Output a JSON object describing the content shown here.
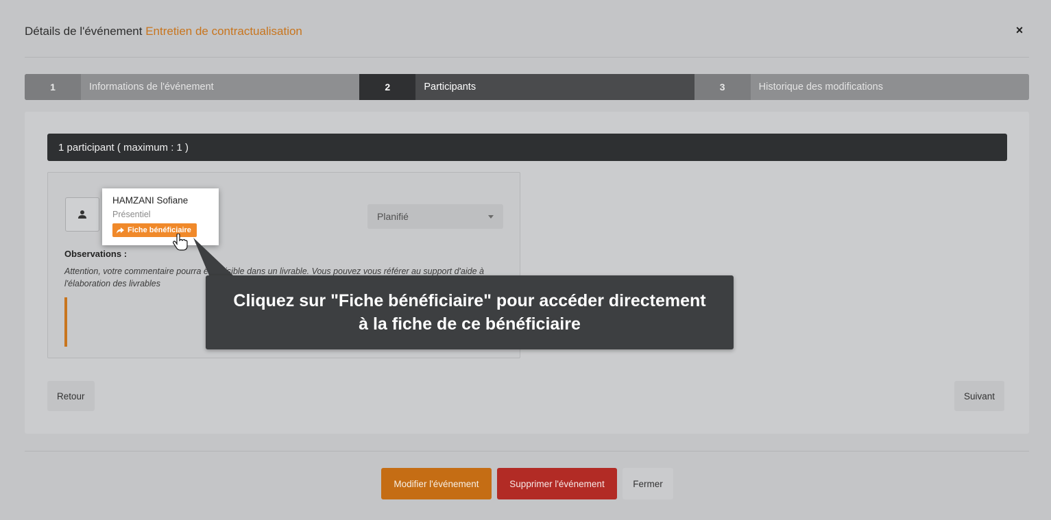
{
  "modal": {
    "title_prefix": "Détails de l'événement",
    "title_event": "Entretien de contractualisation",
    "close_symbol": "×"
  },
  "steps": [
    {
      "num": "1",
      "label": "Informations de l'événement",
      "active": false
    },
    {
      "num": "2",
      "label": "Participants",
      "active": true
    },
    {
      "num": "3",
      "label": "Historique des modifications",
      "active": false
    }
  ],
  "participants": {
    "count_label": "1 participant ( maximum : 1 )",
    "participant": {
      "name": "HAMZANI Sofiane",
      "mode": "Présentiel",
      "fiche_button": "Fiche bénéficiaire",
      "avatar_icon": "user-icon"
    },
    "status_select": {
      "value": "Planifié"
    },
    "observations_title": "Observations :",
    "observations_text": "Attention, votre commentaire pourra être visible dans un livrable. Vous pouvez vous référer au support d'aide à l'élaboration des livrables"
  },
  "nav": {
    "back": "Retour",
    "next": "Suivant"
  },
  "footer": {
    "edit": "Modifier l'événement",
    "delete": "Supprimer l'événement",
    "close": "Fermer"
  },
  "tooltip": {
    "text": "Cliquez sur \"Fiche bénéficiaire\" pour accéder directement à la fiche de ce bénéficiaire"
  },
  "colors": {
    "accent": "#c8751e",
    "delete": "#b22b25",
    "highlight_button": "#f0892a"
  }
}
